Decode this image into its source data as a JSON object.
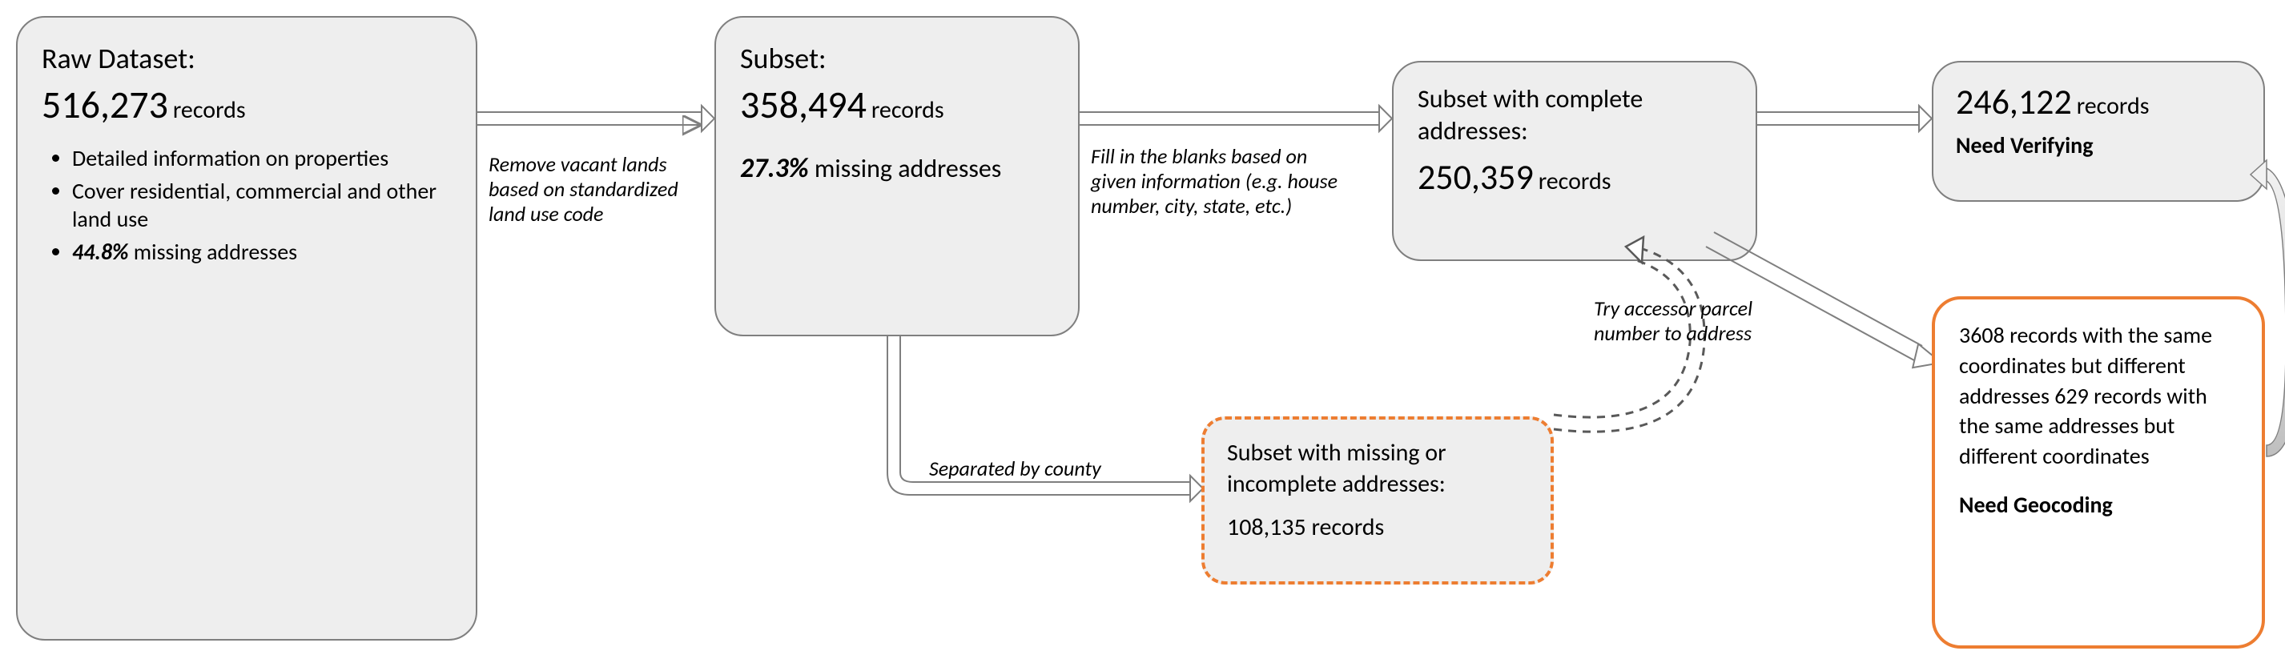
{
  "raw": {
    "title": "Raw Dataset:",
    "count": "516,273",
    "records_word": "records",
    "bullet1": "Detailed information on properties",
    "bullet2": "Cover residential, commercial and other land use",
    "bullet3_pct": "44.8%",
    "bullet3_rest": " missing addresses"
  },
  "arrow1_label": "Remove vacant lands based on standardized land use code",
  "subset": {
    "title": "Subset:",
    "count": "358,494",
    "records_word": "records",
    "pct": "27.3%",
    "rest": " missing addresses"
  },
  "arrow2_label": "Fill in the blanks based on given information (e.g. house number, city, state, etc.)",
  "sep_label": "Separated by county",
  "missing_box": {
    "line1": "Subset with missing or incomplete addresses:",
    "count": "108,135 records"
  },
  "try_label": "Try accessor parcel number to address",
  "complete": {
    "line1": "Subset with complete addresses:",
    "count": "250,359",
    "records_word": "records"
  },
  "verify": {
    "count": "246,122",
    "records_word": "records",
    "need": "Need Verifying"
  },
  "geo": {
    "text": "3608 records with the same coordinates but different addresses   629 records with the same addresses but different coordinates",
    "need": "Need Geocoding"
  }
}
